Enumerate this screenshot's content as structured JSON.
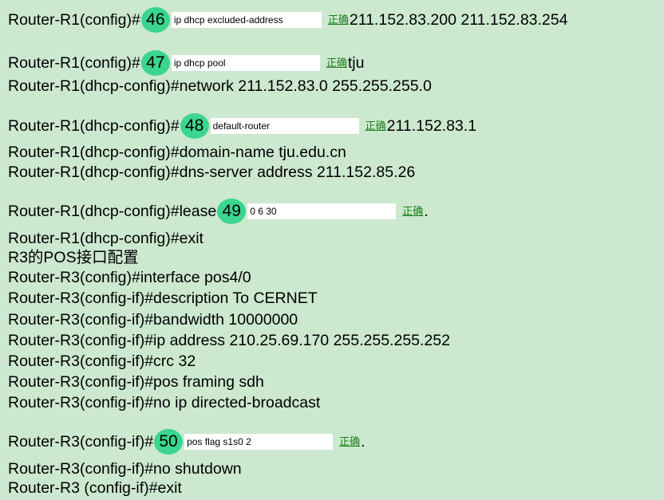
{
  "blanks": [
    {
      "number": "46",
      "value": "ip dhcp excluded-address",
      "status": "正确",
      "prefix": "Router-R1(config)#",
      "suffix": "211.152.83.200 211.152.83.254"
    },
    {
      "number": "47",
      "value": "ip dhcp pool",
      "status": "正确",
      "prefix": "Router-R1(config)#",
      "suffix": "tju"
    },
    {
      "number": "48",
      "value": "default-router",
      "status": "正确",
      "prefix": "Router-R1(dhcp-config)#",
      "suffix": "211.152.83.1"
    },
    {
      "number": "49",
      "value": "0 6 30",
      "status": "正确",
      "prefix": "Router-R1(dhcp-config)#lease",
      "suffix": "."
    },
    {
      "number": "50",
      "value": "pos flag s1s0 2",
      "status": "正确",
      "prefix": "Router-R3(config-if)#",
      "suffix": "."
    }
  ],
  "lines": {
    "network": "Router-R1(dhcp-config)#network 211.152.83.0 255.255.255.0",
    "domain_name": "Router-R1(dhcp-config)#domain-name tju.edu.cn",
    "dns_server": "Router-R1(dhcp-config)#dns-server address 211.152.85.26",
    "exit_r1": "Router-R1(dhcp-config)#exit",
    "r3_heading": "R3的POS接口配置",
    "interface": "Router-R3(config)#interface pos4/0",
    "description": "Router-R3(config-if)#description To CERNET",
    "bandwidth": "Router-R3(config-if)#bandwidth 10000000",
    "ip_address": "Router-R3(config-if)#ip address 210.25.69.170 255.255.255.252",
    "crc": "Router-R3(config-if)#crc 32",
    "framing": "Router-R3(config-if)#pos framing sdh",
    "no_broadcast": "Router-R3(config-if)#no ip directed-broadcast",
    "no_shutdown": "Router-R3(config-if)#no shutdown",
    "exit_r3": "Router-R3 (config-if)#exit"
  }
}
